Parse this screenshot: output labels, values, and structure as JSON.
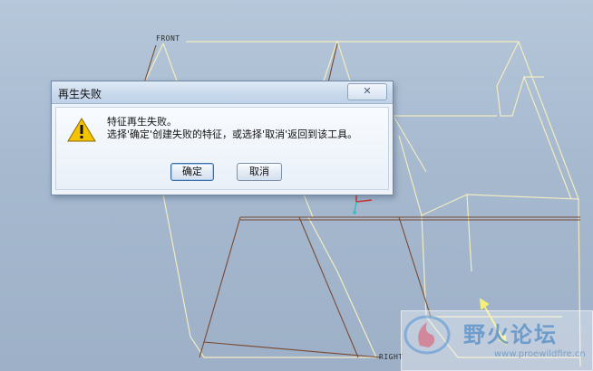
{
  "viewport": {
    "datum_front_label": "FRONT",
    "datum_right_label": "RIGHT"
  },
  "dialog": {
    "title": "再生失败",
    "close_glyph": "✕",
    "icon": "warning-icon",
    "message_line1": "特征再生失败。",
    "message_line2": "选择'确定'创建失败的特征，或选择'取消'返回到该工具。",
    "ok_label": "确定",
    "cancel_label": "取消"
  },
  "watermark": {
    "name": "野火论坛",
    "url": "www.proewildfire.cn"
  },
  "colors": {
    "viewport_background": "#a6b9cf",
    "edge_yellow": "#f3ecc0",
    "edge_brown": "#7a4a32",
    "dialog_border": "#6f87a3",
    "warning_yellow": "#f5c400"
  }
}
